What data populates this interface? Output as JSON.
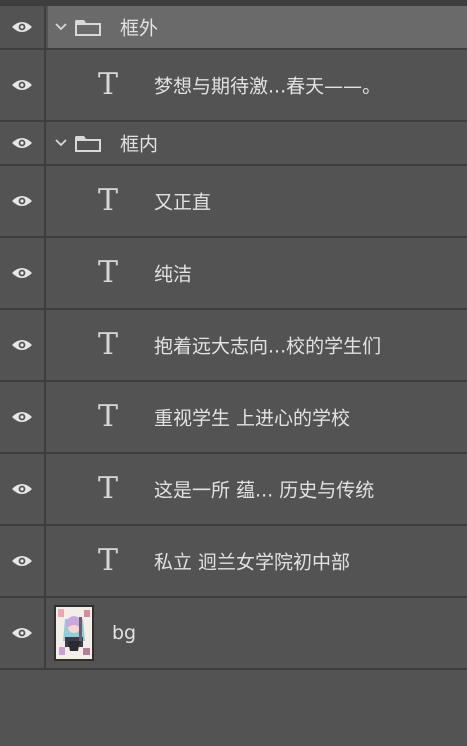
{
  "layers": [
    {
      "kind": "group",
      "name": "框外",
      "visible": true,
      "expanded": true,
      "selected": true
    },
    {
      "kind": "text",
      "name": "梦想与期待激...春天——。",
      "visible": true
    },
    {
      "kind": "group",
      "name": "框内",
      "visible": true,
      "expanded": true,
      "selected": false
    },
    {
      "kind": "text",
      "name": "又正直",
      "visible": true
    },
    {
      "kind": "text",
      "name": "纯洁",
      "visible": true
    },
    {
      "kind": "text",
      "name": "抱着远大志向...校的学生们",
      "visible": true
    },
    {
      "kind": "text",
      "name": "重视学生 上进心的学校",
      "visible": true
    },
    {
      "kind": "text",
      "name": "这是一所 蕴... 历史与传统",
      "visible": true
    },
    {
      "kind": "text",
      "name": "私立 迥兰女学院初中部",
      "visible": true
    },
    {
      "kind": "image",
      "name": "bg",
      "visible": true
    }
  ],
  "icons": {
    "visibility": "eye-icon",
    "expand": "chevron-down-icon",
    "group": "folder-icon",
    "text_layer": "text-layer-icon",
    "image_layer": "layer-thumbnail"
  },
  "text_layer_glyph": "T",
  "colors": {
    "panel_bg": "#535353",
    "row_divider": "#3e3e3e",
    "selected_row_bg": "#6a6a6a",
    "label_text": "#e2e2e2",
    "icon": "#d8d8d8"
  }
}
